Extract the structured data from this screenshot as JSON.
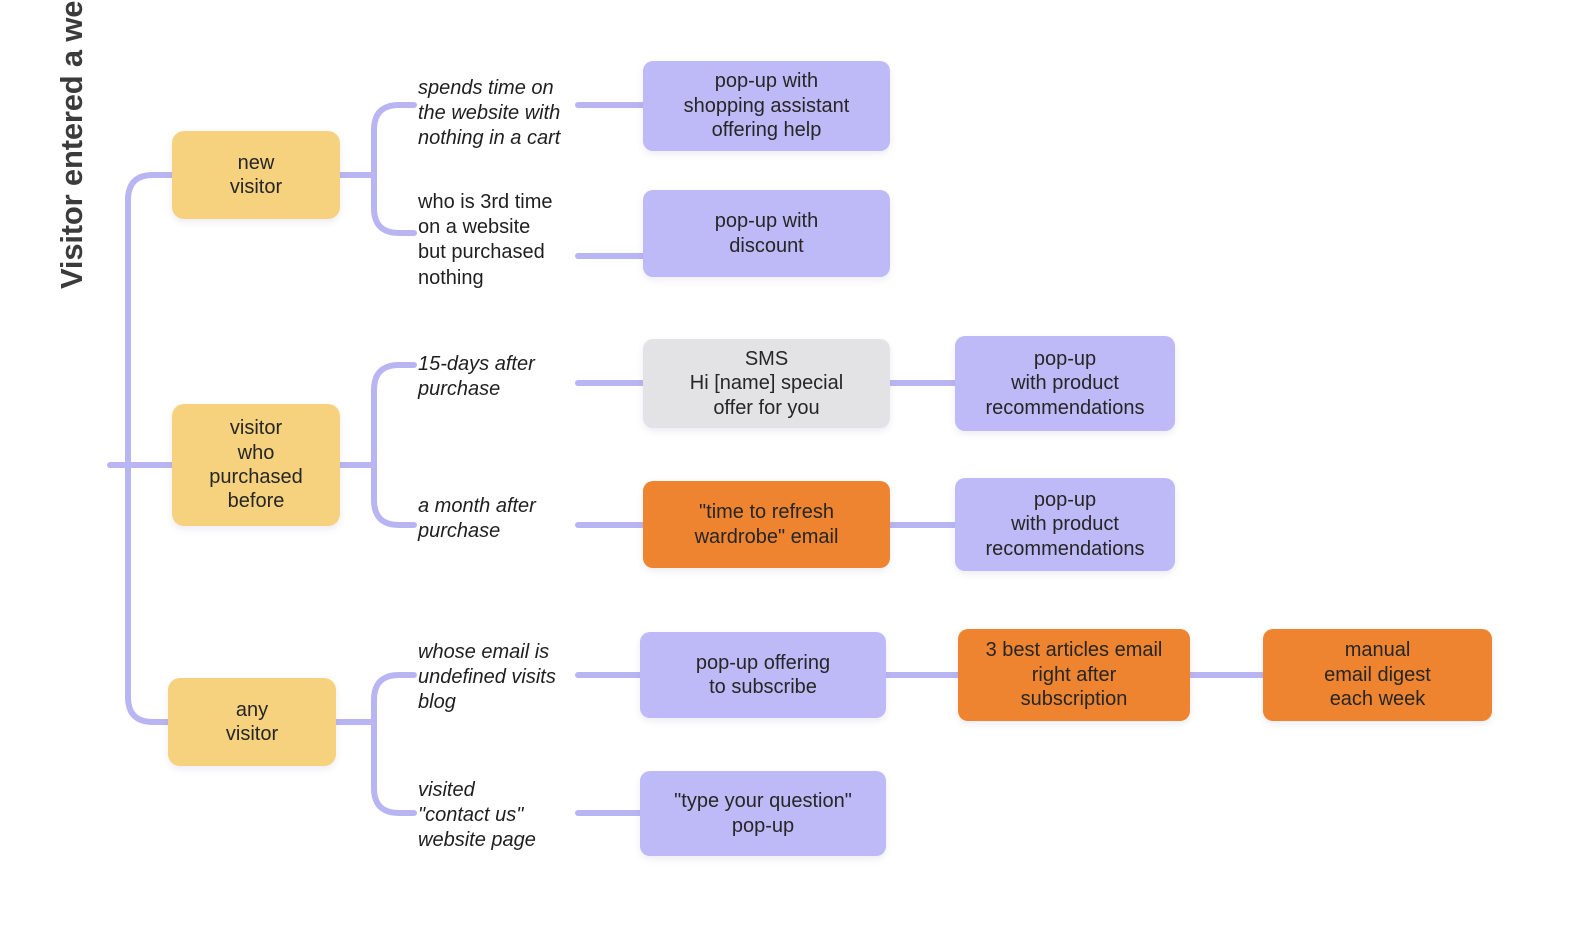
{
  "diagram": {
    "root": {
      "label": "Visitor entered a website"
    },
    "colors": {
      "segment": "#f6d27f",
      "popup": "#bdbaf7",
      "sms": "#e3e3e6",
      "email": "#ee8430",
      "connector": "#b8b5f2",
      "text": "#262626"
    },
    "segments": [
      {
        "id": "new-visitor",
        "label": "new\nvisitor"
      },
      {
        "id": "purchased-before",
        "label": "visitor\nwho\npurchased\nbefore"
      },
      {
        "id": "any-visitor",
        "label": "any\nvisitor"
      }
    ],
    "conditions": [
      {
        "id": "cond-idle-cart",
        "label": "spends time on\nthe website with\nnothing in a cart",
        "italic": true
      },
      {
        "id": "cond-3rd-time",
        "label": "who is 3rd time\non a website\nbut purchased\nnothing",
        "italic": false
      },
      {
        "id": "cond-15-days",
        "label": "15-days after\npurchase",
        "italic": true
      },
      {
        "id": "cond-month-after",
        "label": "a month after\npurchase",
        "italic": true
      },
      {
        "id": "cond-blog-visit",
        "label": "whose email is\nundefined visits\nblog",
        "italic": true
      },
      {
        "id": "cond-contact-us",
        "label": "visited\n\"contact us\"\nwebsite page",
        "italic": true
      }
    ],
    "actions": [
      {
        "id": "act-shopping-assistant",
        "label": "pop-up with\nshopping assistant\noffering help",
        "kind": "popup"
      },
      {
        "id": "act-discount-popup",
        "label": "pop-up with\ndiscount",
        "kind": "popup"
      },
      {
        "id": "act-sms",
        "label": "SMS\nHi [name] special\noffer for you",
        "kind": "sms"
      },
      {
        "id": "act-recs-1",
        "label": "pop-up\nwith product\nrecommendations",
        "kind": "popup"
      },
      {
        "id": "act-refresh-wardrobe",
        "label": "\"time to refresh\nwardrobe\" email",
        "kind": "email"
      },
      {
        "id": "act-recs-2",
        "label": "pop-up\nwith product\nrecommendations",
        "kind": "popup"
      },
      {
        "id": "act-subscribe-popup",
        "label": "pop-up offering\nto subscribe",
        "kind": "popup"
      },
      {
        "id": "act-3-best-articles",
        "label": "3 best articles email\nright after\nsubscription",
        "kind": "email"
      },
      {
        "id": "act-weekly-digest",
        "label": "manual\nemail digest\neach week",
        "kind": "email"
      },
      {
        "id": "act-type-question",
        "label": "\"type your question\"\npop-up",
        "kind": "popup"
      }
    ]
  }
}
